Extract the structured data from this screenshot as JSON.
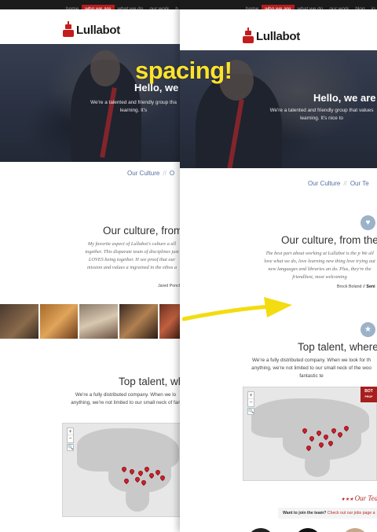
{
  "annotation": "spacing!",
  "nav": {
    "left": [
      "home",
      "who we are",
      "what we do",
      "our work",
      "b"
    ],
    "right": [
      "home",
      "who we are",
      "what we do",
      "our work",
      "blog",
      "jo"
    ],
    "active": "who we are"
  },
  "logo": {
    "text": "Lullabot",
    "color": "#c41c1c"
  },
  "left": {
    "hero_title": "Hello, we",
    "hero_text": "We're a talented and friendly group tha learning. It's",
    "subnav": [
      "Our Culture",
      "O"
    ],
    "culture_title": "Our culture, from",
    "culture_quote": "My favorite aspect of Lullabot's culture a all together. This disparate team of disciplines just LOVES being together. H see proof that our mission and values a ingrained in the ethos a",
    "culture_cite": "Jared Ponch",
    "talent_title": "Top talent, wh",
    "talent_text": "We're a fully distributed company. When we lo anything, we're not limited to our small neck of fan"
  },
  "right": {
    "hero_title": "Hello, we are",
    "hero_text": "We're a talented and friendly group that values learning. It's nice to",
    "subnav": [
      "Our Culture",
      "Our Te"
    ],
    "culture_icon": "heart-icon",
    "culture_title": "Our culture, from the",
    "culture_quote": "The best part about working at Lullabot is the p We all love what we do, love learning new thing love trying out new languages and libraries an do. Plus, they're the friendliest, most welcoming",
    "culture_cite_name": "Brock Boland",
    "culture_cite_role": "Seni",
    "talent_icon": "star-icon",
    "talent_title": "Top talent, where",
    "talent_text": "We're a fully distributed company. When we look for th anything, we're not limited to our small neck of the woo fantastic te",
    "badge_line1": "BOT",
    "badge_line2": "PROP",
    "our_team": "Our Tea",
    "join_text": "Want to join the team?",
    "join_link": "Check out our jobs page a"
  },
  "map": {
    "zoom_in": "+",
    "zoom_out": "−",
    "search": "🔍"
  },
  "colors": {
    "accent": "#b41e1e",
    "link": "#5570a0",
    "arrow": "#f3dc10"
  }
}
